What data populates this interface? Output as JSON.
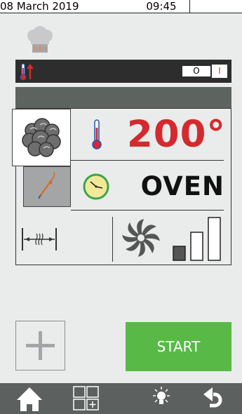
{
  "status_bar": {
    "date": "08 March 2019",
    "time": "09:45"
  },
  "temperature_bar": {
    "toggle_off_label": "O",
    "toggle_on_label": "I"
  },
  "program": {
    "temperature": "200°",
    "mode": "OVEN",
    "fan_speed_level": 1,
    "fan_speed_max": 3
  },
  "actions": {
    "start_label": "START"
  },
  "colors": {
    "accent_red": "#d42a2f",
    "start_green": "#58b947",
    "dark_bar": "#2d2d2d",
    "nav_bar": "#5c605e",
    "screen_background": "#e9eceb"
  },
  "icons": {
    "header": [
      "chef-hat-icon"
    ],
    "temperature_bar": [
      "thermometer-up-icon"
    ],
    "panel": [
      "cooking-cycle-icon",
      "probe-icon",
      "thermometer-icon",
      "clock-icon",
      "half-load-icon",
      "fan-icon",
      "fan-speed-bars-icon"
    ],
    "nav": [
      "home-icon",
      "grid-add-icon",
      "light-icon",
      "back-arrow-icon"
    ],
    "bottom": [
      "add-icon"
    ]
  }
}
